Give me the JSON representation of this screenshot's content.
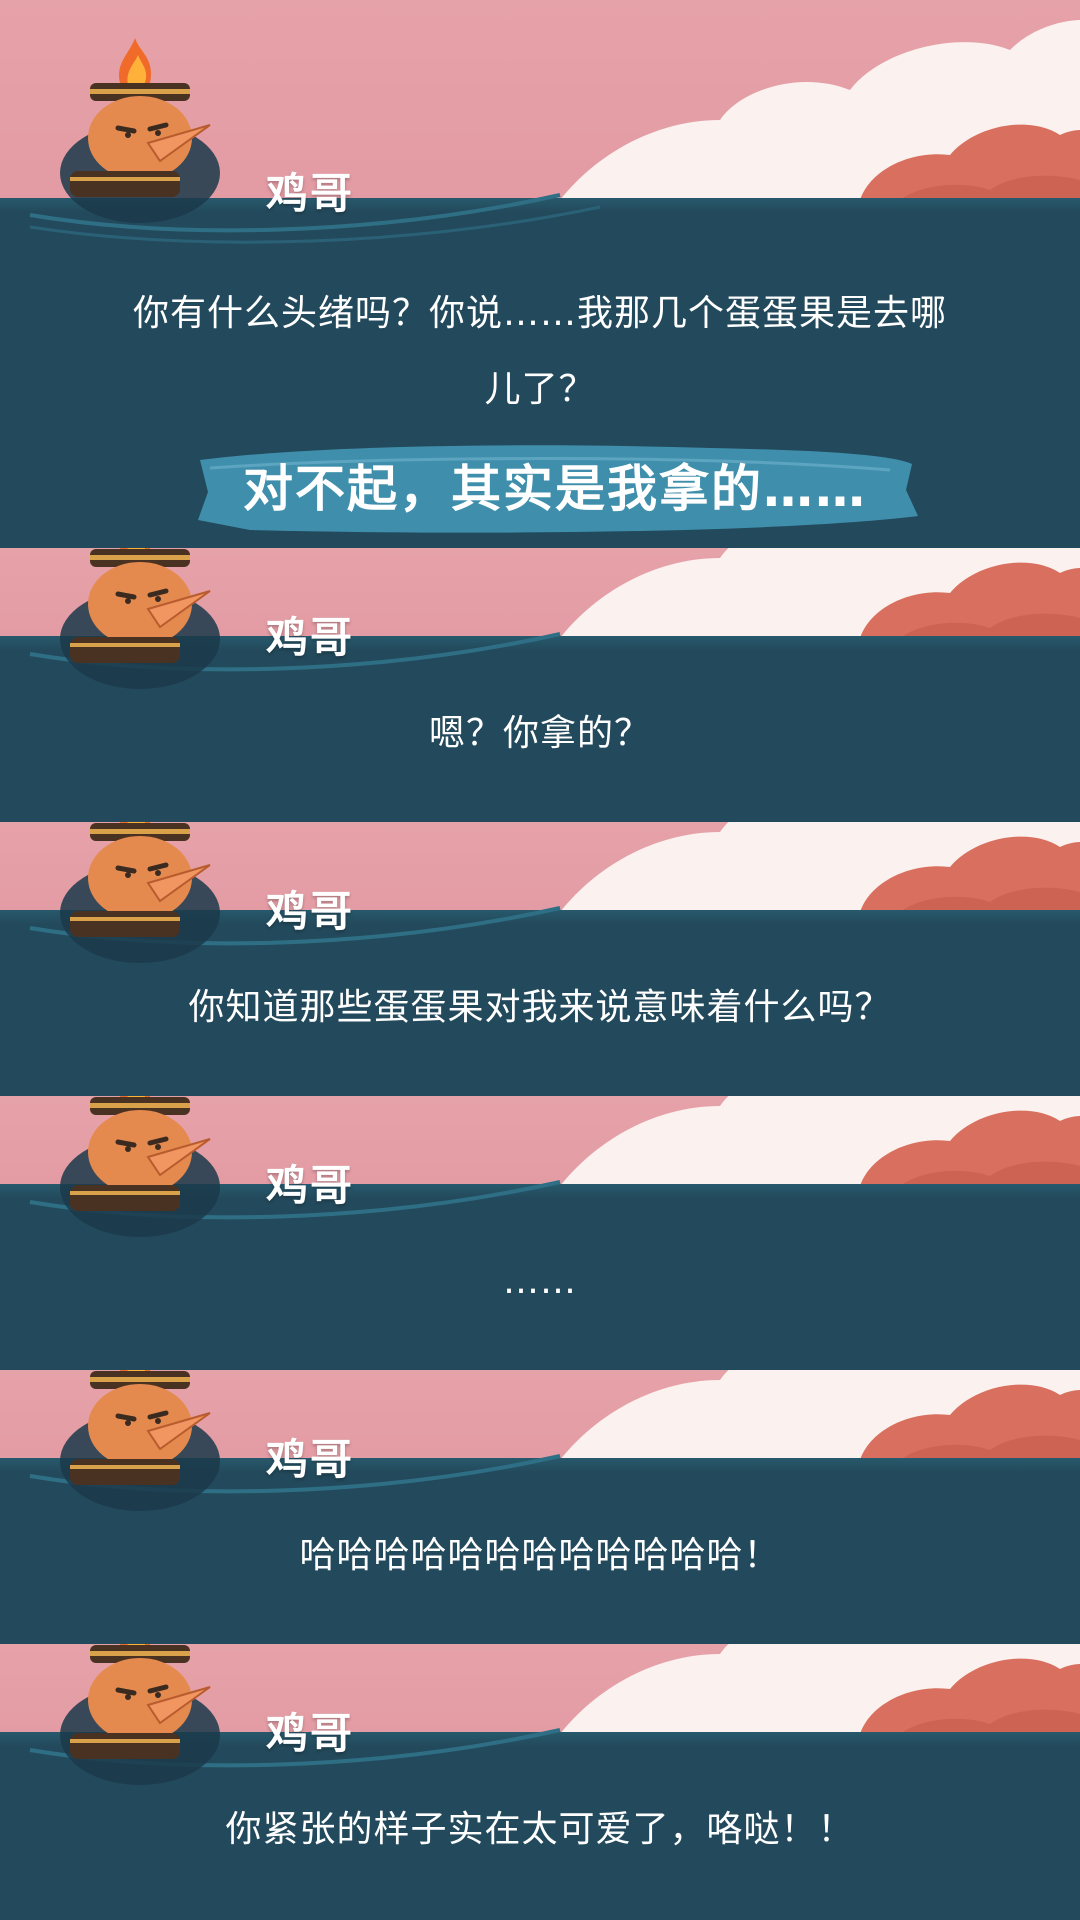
{
  "speaker": "鸡哥",
  "dialogues": [
    {
      "speaker": "鸡哥",
      "line1": "你有什么头绪吗？你说……我那几个蛋蛋果是去哪",
      "line2": "儿了？",
      "choice": "对不起，其实是我拿的……"
    },
    {
      "speaker": "鸡哥",
      "text": "嗯？你拿的？"
    },
    {
      "speaker": "鸡哥",
      "text": "你知道那些蛋蛋果对我来说意味着什么吗？"
    },
    {
      "speaker": "鸡哥",
      "text": "……"
    },
    {
      "speaker": "鸡哥",
      "text": "哈哈哈哈哈哈哈哈哈哈哈哈！"
    },
    {
      "speaker": "鸡哥",
      "text": "你紧张的样子实在太可爱了，咯哒！！"
    }
  ],
  "colors": {
    "sky_pink": "#e6a2a9",
    "cloud_white": "#fbf1ee",
    "cloud_coral": "#d9705f",
    "dialog_navy": "#234a5c",
    "choice_teal": "#3f8fac",
    "text_white": "#ffffff"
  },
  "icons": {
    "avatar": "chicken-character-with-flame-hat",
    "decor": "cloud-decoration"
  }
}
